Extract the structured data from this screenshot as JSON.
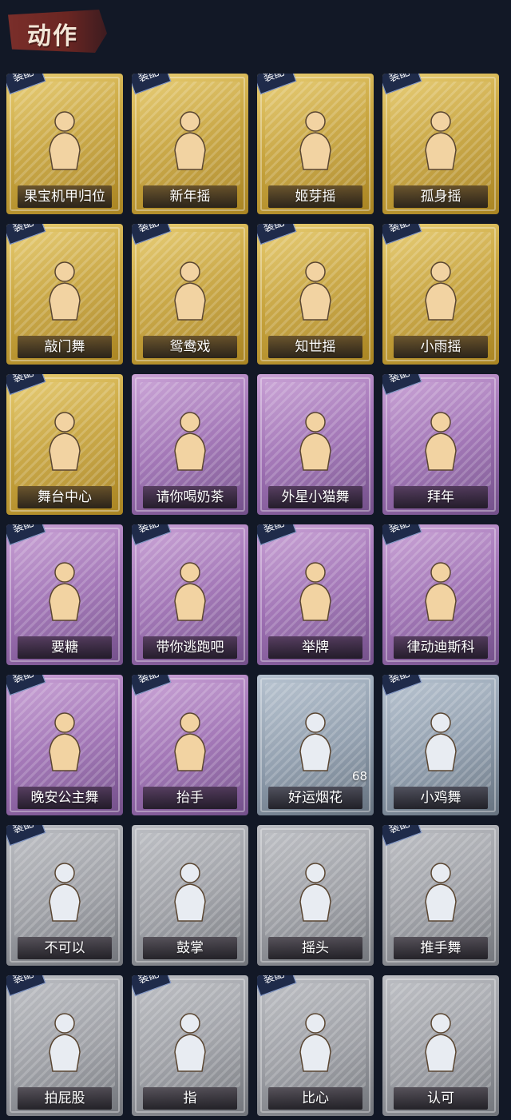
{
  "header": {
    "title": "动作"
  },
  "equip_badge": "装配",
  "colors": {
    "gold": "#c9a640",
    "purple": "#9f71b4",
    "blue": "#8c9aaa",
    "grey": "#9a9ca2",
    "background": "#121826"
  },
  "cards": [
    {
      "name": "果宝机甲归位",
      "rarity": "gold",
      "equipped": true
    },
    {
      "name": "新年摇",
      "rarity": "gold",
      "equipped": true
    },
    {
      "name": "姬芽摇",
      "rarity": "gold",
      "equipped": true
    },
    {
      "name": "孤身摇",
      "rarity": "gold",
      "equipped": true
    },
    {
      "name": "敲门舞",
      "rarity": "gold",
      "equipped": true
    },
    {
      "name": "鸳鸯戏",
      "rarity": "gold",
      "equipped": true
    },
    {
      "name": "知世摇",
      "rarity": "gold",
      "equipped": true
    },
    {
      "name": "小雨摇",
      "rarity": "gold",
      "equipped": true
    },
    {
      "name": "舞台中心",
      "rarity": "gold",
      "equipped": true
    },
    {
      "name": "请你喝奶茶",
      "rarity": "purple",
      "equipped": false
    },
    {
      "name": "外星小猫舞",
      "rarity": "purple",
      "equipped": false
    },
    {
      "name": "拜年",
      "rarity": "purple",
      "equipped": true
    },
    {
      "name": "要糖",
      "rarity": "purple",
      "equipped": true
    },
    {
      "name": "带你逃跑吧",
      "rarity": "purple",
      "equipped": true
    },
    {
      "name": "举牌",
      "rarity": "purple",
      "equipped": true
    },
    {
      "name": "律动迪斯科",
      "rarity": "purple",
      "equipped": true
    },
    {
      "name": "晚安公主舞",
      "rarity": "purple",
      "equipped": true
    },
    {
      "name": "抬手",
      "rarity": "purple",
      "equipped": true
    },
    {
      "name": "好运烟花",
      "rarity": "blue",
      "equipped": false,
      "count": "68"
    },
    {
      "name": "小鸡舞",
      "rarity": "blue",
      "equipped": true
    },
    {
      "name": "不可以",
      "rarity": "grey",
      "equipped": true
    },
    {
      "name": "鼓掌",
      "rarity": "grey",
      "equipped": false
    },
    {
      "name": "摇头",
      "rarity": "grey",
      "equipped": false
    },
    {
      "name": "推手舞",
      "rarity": "grey",
      "equipped": true
    },
    {
      "name": "拍屁股",
      "rarity": "grey",
      "equipped": true
    },
    {
      "name": "指",
      "rarity": "grey",
      "equipped": true
    },
    {
      "name": "比心",
      "rarity": "grey",
      "equipped": true
    },
    {
      "name": "认可",
      "rarity": "grey",
      "equipped": false
    }
  ]
}
